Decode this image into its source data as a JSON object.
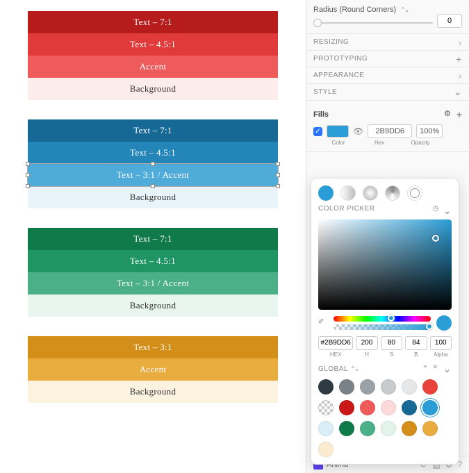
{
  "canvas": {
    "groups": [
      {
        "rows": [
          {
            "label": "Text – 7:1",
            "bg": "#b71c1c",
            "fg": "#fff"
          },
          {
            "label": "Text – 4.5:1",
            "bg": "#e03a3a",
            "fg": "#fff"
          },
          {
            "label": "Accent",
            "bg": "#ef5b5b",
            "fg": "#fff"
          },
          {
            "label": "Background",
            "bg": "#fdecec",
            "fg": "#333"
          }
        ]
      },
      {
        "rows": [
          {
            "label": "Text – 7:1",
            "bg": "#176995",
            "fg": "#fff"
          },
          {
            "label": "Text – 4.5:1",
            "bg": "#2486b8",
            "fg": "#fff"
          },
          {
            "label": "Text – 3:1 / Accent",
            "bg": "#4fabd8",
            "fg": "#fff",
            "selected": true
          },
          {
            "label": "Background",
            "bg": "#e8f4f9",
            "fg": "#333"
          }
        ]
      },
      {
        "rows": [
          {
            "label": "Text – 7:1",
            "bg": "#117a4b",
            "fg": "#fff"
          },
          {
            "label": "Text – 4.5:1",
            "bg": "#1f9564",
            "fg": "#fff"
          },
          {
            "label": "Text – 3:1 / Accent",
            "bg": "#4bb088",
            "fg": "#fff"
          },
          {
            "label": "Background",
            "bg": "#e9f6f0",
            "fg": "#333"
          }
        ]
      },
      {
        "rows": [
          {
            "label": "Text – 3:1",
            "bg": "#d38f19",
            "fg": "#fff"
          },
          {
            "label": "Accent",
            "bg": "#e9ad3f",
            "fg": "#fff"
          },
          {
            "label": "Background",
            "bg": "#fcf2e0",
            "fg": "#333"
          }
        ]
      }
    ]
  },
  "inspector": {
    "radius": {
      "label": "Radius (Round Corners)",
      "value": "0"
    },
    "sections": {
      "resizing": "RESIZING",
      "prototyping": "PROTOTYPING",
      "appearance": "APPEARANCE",
      "style": "STYLE"
    },
    "fills": {
      "title": "Fills",
      "swatch": "#2b9dd6",
      "hex": "2B9DD6",
      "opacity": "100%",
      "labels": {
        "color": "Color",
        "hex": "Hex",
        "opacity": "Opacity"
      }
    }
  },
  "picker": {
    "title": "COLOR PICKER",
    "hex": "2B9DD6",
    "h": "200",
    "s": "80",
    "b": "84",
    "alpha": "100",
    "labels": {
      "hex": "HEX",
      "h": "H",
      "s": "S",
      "b": "B",
      "alpha": "Alpha"
    },
    "big_swatch": "#2b9dd6",
    "global_title": "GLOBAL",
    "swatches": [
      "#2e3b42",
      "#7a8288",
      "#9ba2a7",
      "#c7cbce",
      "#e5e7e9",
      "#e9423a",
      "checker",
      "#c91818",
      "#ef5b5b",
      "#fcdada",
      "#176995",
      "#2b9dd6",
      "#d9eef7",
      "#117a4b",
      "#4bb088",
      "#e1f3eb",
      "#d38f19",
      "#e9ad3f",
      "#fbecd0"
    ],
    "selected_swatch_index": 11
  },
  "anima": {
    "label": "Anima"
  }
}
